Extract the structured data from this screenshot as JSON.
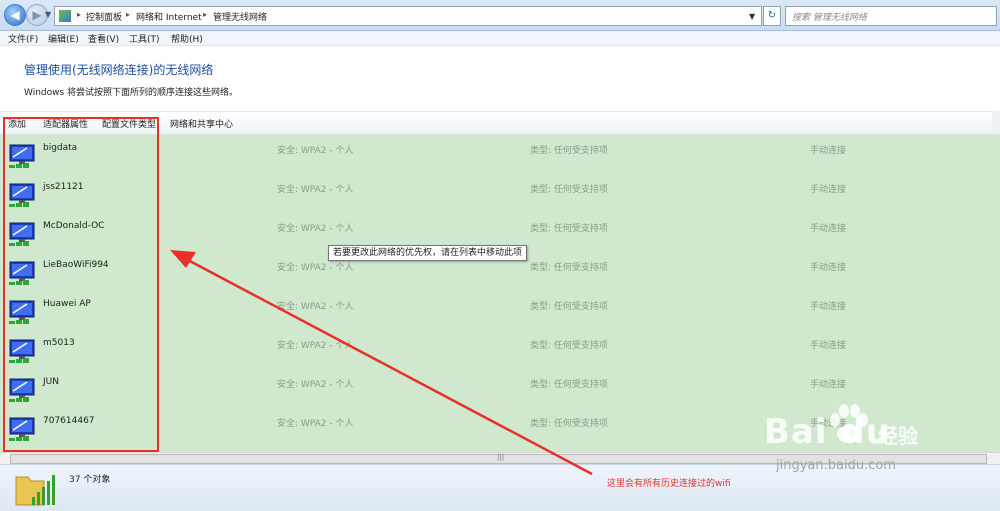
{
  "address": {
    "breadcrumbs": [
      "控制面板",
      "网络和 Internet",
      "管理无线网络"
    ],
    "search_placeholder": "搜索 管理无线网络"
  },
  "menu": [
    "文件(F)",
    "编辑(E)",
    "查看(V)",
    "工具(T)",
    "帮助(H)"
  ],
  "page": {
    "title": "管理使用(无线网络连接)的无线网络",
    "subtitle": "Windows 将尝试按照下面所列的顺序连接这些网络。"
  },
  "toolbar": [
    "添加",
    "适配器属性",
    "配置文件类型",
    "网络和共享中心"
  ],
  "networks": [
    {
      "name": "bigdata",
      "security": "安全: WPA2 - 个人",
      "type": "类型: 任何受支持项",
      "mode": "手动连接"
    },
    {
      "name": "jss21121",
      "security": "安全: WPA2 - 个人",
      "type": "类型: 任何受支持项",
      "mode": "手动连接"
    },
    {
      "name": "McDonald-OC",
      "security": "安全: WPA2 - 个人",
      "type": "类型: 任何受支持项",
      "mode": "手动连接"
    },
    {
      "name": "LieBaoWiFi994",
      "security": "安全: WPA2 - 个人",
      "type": "类型: 任何受支持项",
      "mode": "手动连接"
    },
    {
      "name": "Huawei AP",
      "security": "安全: WPA2 - 个人",
      "type": "类型: 任何受支持项",
      "mode": "手动连接"
    },
    {
      "name": "m5013",
      "security": "安全: WPA2 - 个人",
      "type": "类型: 任何受支持项",
      "mode": "手动连接"
    },
    {
      "name": "JUN",
      "security": "安全: WPA2 - 个人",
      "type": "类型: 任何受支持项",
      "mode": "手动连接"
    },
    {
      "name": "707614467",
      "security": "安全: WPA2 - 个人",
      "type": "类型: 任何受支持项",
      "mode": "手动连接"
    }
  ],
  "tooltip": "若要更改此网络的优先权，请在列表中移动此项",
  "status": {
    "count": "37 个对象"
  },
  "annotation": "这里会有所有历史连接过的wifi",
  "watermark": {
    "logo": "Bai du",
    "jingyan": "经验",
    "url": "jingyan.baidu.com"
  },
  "colors": {
    "list_bg": "#cfe8ce",
    "accent_red": "#e8302a",
    "heading_blue": "#1f4fa0"
  },
  "icons": {
    "back": "back-arrow-icon",
    "forward": "forward-arrow-icon",
    "wifi": "wireless-network-icon"
  }
}
